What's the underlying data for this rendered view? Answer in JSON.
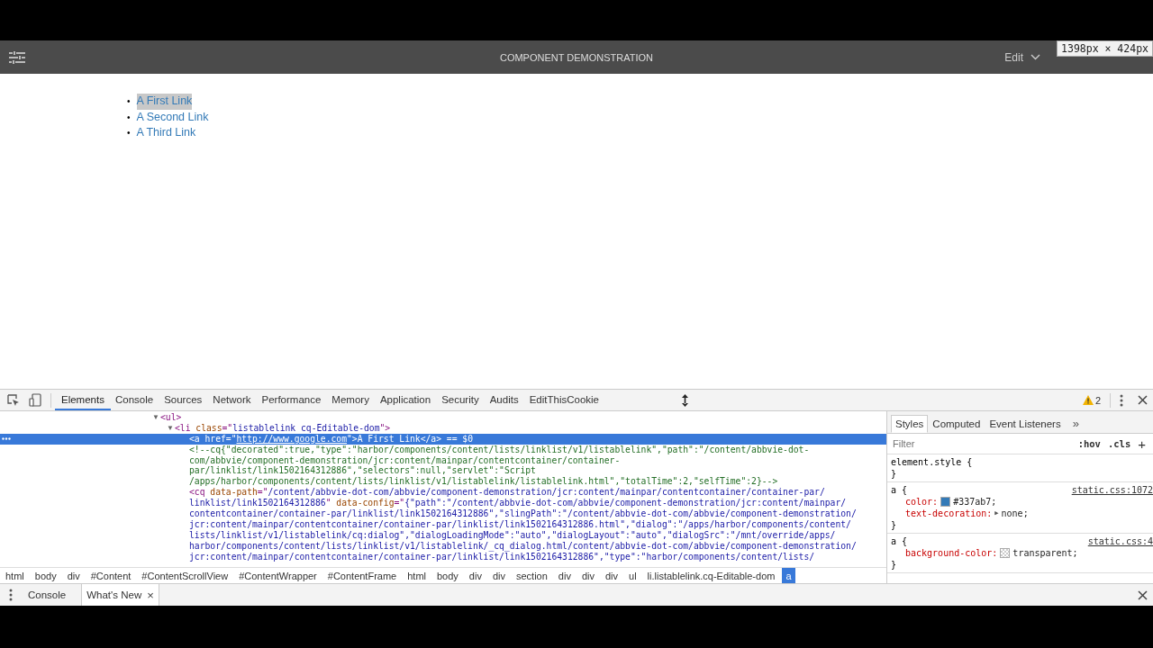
{
  "toolbar": {
    "title": "COMPONENT DEMONSTRATION",
    "mode": "Edit",
    "size_tooltip": "1398px × 424px"
  },
  "page": {
    "links": [
      {
        "bullet": "•",
        "text": "A First Link",
        "selected": true
      },
      {
        "bullet": "•",
        "text": "A Second Link",
        "selected": false
      },
      {
        "bullet": "•",
        "text": "A Third Link",
        "selected": false
      }
    ]
  },
  "devtools": {
    "tabs": [
      {
        "label": "Elements",
        "selected": true
      },
      {
        "label": "Console",
        "selected": false
      },
      {
        "label": "Sources",
        "selected": false
      },
      {
        "label": "Network",
        "selected": false
      },
      {
        "label": "Performance",
        "selected": false
      },
      {
        "label": "Memory",
        "selected": false
      },
      {
        "label": "Application",
        "selected": false
      },
      {
        "label": "Security",
        "selected": false
      },
      {
        "label": "Audits",
        "selected": false
      },
      {
        "label": "EditThisCookie",
        "selected": false
      }
    ],
    "warnings": "2",
    "elements": [
      {
        "arrow": "▼",
        "selected": false,
        "segments": [
          {
            "kind": "tag",
            "text": "<ul>"
          }
        ],
        "children": [
          {
            "arrow": "▼",
            "selected": false,
            "segments": [
              {
                "kind": "tag",
                "text": "<li "
              },
              {
                "kind": "attr",
                "text": "class"
              },
              {
                "kind": "tag",
                "text": "=\""
              },
              {
                "kind": "value",
                "text": "listablelink cq-Editable-dom"
              },
              {
                "kind": "tag",
                "text": "\">"
              }
            ],
            "children": [
              {
                "selected": true,
                "segments": [
                  {
                    "kind": "tag",
                    "text": "<a "
                  },
                  {
                    "kind": "attr",
                    "text": "href"
                  },
                  {
                    "kind": "tag",
                    "text": "=\""
                  },
                  {
                    "kind": "link",
                    "text": "http://www.google.com"
                  },
                  {
                    "kind": "tag",
                    "text": "\">"
                  },
                  {
                    "kind": "text",
                    "text": "A First Link"
                  },
                  {
                    "kind": "tag",
                    "text": "</a>"
                  },
                  {
                    "kind": "marker",
                    "text": " == $0"
                  }
                ]
              },
              {
                "selected": false,
                "segments": [
                  {
                    "kind": "comment",
                    "text": "<!--cq{\"decorated\":true,\"type\":\"harbor/components/content/lists/linklist/v1/listablelink\",\"path\":\"/content/abbvie-dot-"
                  }
                ]
              },
              {
                "selected": false,
                "segments": [
                  {
                    "kind": "comment",
                    "text": "com/abbvie/component-demonstration/jcr:content/mainpar/contentcontainer/container-"
                  }
                ]
              },
              {
                "selected": false,
                "segments": [
                  {
                    "kind": "comment",
                    "text": "par/linklist/link1502164312886\",\"selectors\":null,\"servlet\":\"Script"
                  }
                ]
              },
              {
                "selected": false,
                "segments": [
                  {
                    "kind": "comment",
                    "text": "/apps/harbor/components/content/lists/linklist/v1/listablelink/listablelink.html\",\"totalTime\":2,\"selfTime\":2}-->"
                  }
                ]
              },
              {
                "selected": false,
                "segments": [
                  {
                    "kind": "tag",
                    "text": "<cq "
                  },
                  {
                    "kind": "attr",
                    "text": "data-path"
                  },
                  {
                    "kind": "tag",
                    "text": "=\""
                  },
                  {
                    "kind": "value",
                    "text": "/content/abbvie-dot-com/abbvie/component-demonstration/jcr:content/mainpar/contentcontainer/container-par/"
                  }
                ]
              },
              {
                "selected": false,
                "segments": [
                  {
                    "kind": "value",
                    "text": "linklist/link1502164312886"
                  },
                  {
                    "kind": "tag",
                    "text": "\" "
                  },
                  {
                    "kind": "attr",
                    "text": "data-config"
                  },
                  {
                    "kind": "tag",
                    "text": "=\""
                  },
                  {
                    "kind": "value",
                    "text": "{\"path\":\"/content/abbvie-dot-com/abbvie/component-demonstration/jcr:content/mainpar/"
                  }
                ]
              },
              {
                "selected": false,
                "segments": [
                  {
                    "kind": "value",
                    "text": "contentcontainer/container-par/linklist/link1502164312886\",\"slingPath\":\"/content/abbvie-dot-com/abbvie/component-demonstration/"
                  }
                ]
              },
              {
                "selected": false,
                "segments": [
                  {
                    "kind": "value",
                    "text": "jcr:content/mainpar/contentcontainer/container-par/linklist/link1502164312886.html\",\"dialog\":\"/apps/harbor/components/content/"
                  }
                ]
              },
              {
                "selected": false,
                "segments": [
                  {
                    "kind": "value",
                    "text": "lists/linklist/v1/listablelink/cq:dialog\",\"dialogLoadingMode\":\"auto\",\"dialogLayout\":\"auto\",\"dialogSrc\":\"/mnt/override/apps/"
                  }
                ]
              },
              {
                "selected": false,
                "segments": [
                  {
                    "kind": "value",
                    "text": "harbor/components/content/lists/linklist/v1/listablelink/_cq_dialog.html/content/abbvie-dot-com/abbvie/component-demonstration/"
                  }
                ]
              },
              {
                "selected": false,
                "segments": [
                  {
                    "kind": "value",
                    "text": "jcr:content/mainpar/contentcontainer/container-par/linklist/link1502164312886\",\"type\":\"harbor/components/content/lists/"
                  }
                ]
              }
            ]
          }
        ]
      }
    ],
    "breadcrumbs": [
      {
        "label": "html",
        "selected": false
      },
      {
        "label": "body",
        "selected": false
      },
      {
        "label": "div",
        "selected": false
      },
      {
        "label": "#Content",
        "selected": false
      },
      {
        "label": "#ContentScrollView",
        "selected": false
      },
      {
        "label": "#ContentWrapper",
        "selected": false
      },
      {
        "label": "#ContentFrame",
        "selected": false
      },
      {
        "label": "html",
        "selected": false
      },
      {
        "label": "body",
        "selected": false
      },
      {
        "label": "div",
        "selected": false
      },
      {
        "label": "div",
        "selected": false
      },
      {
        "label": "section",
        "selected": false
      },
      {
        "label": "div",
        "selected": false
      },
      {
        "label": "div",
        "selected": false
      },
      {
        "label": "div",
        "selected": false
      },
      {
        "label": "ul",
        "selected": false
      },
      {
        "label": "li.listablelink.cq-Editable-dom",
        "selected": false
      },
      {
        "label": "a",
        "selected": true
      }
    ],
    "styles": {
      "tabs": [
        {
          "label": "Styles",
          "selected": true
        },
        {
          "label": "Computed",
          "selected": false
        },
        {
          "label": "Event Listeners",
          "selected": false
        }
      ],
      "more": "»",
      "filter": {
        "placeholder": "Filter"
      },
      "hov": ":hov",
      "cls": ".cls",
      "add": "+",
      "rules": [
        {
          "selector": "element.style {",
          "close": "}"
        },
        {
          "selector": "a {",
          "source": "static.css:1072",
          "declarations": [
            {
              "kind": "color",
              "property": "color:",
              "value": "#337ab7;",
              "color": "#337ab7"
            },
            {
              "kind": "plain",
              "property": "text-decoration:",
              "toggle": "▶",
              "value": "none;"
            }
          ],
          "close": "}"
        },
        {
          "selector": "a {",
          "source": "static.css:4",
          "declarations": [
            {
              "kind": "transparent",
              "property": "background-color:",
              "value": "transparent;"
            }
          ],
          "close": "}"
        }
      ]
    }
  },
  "drawer": {
    "tabs": [
      {
        "label": "Console",
        "selected": false
      },
      {
        "label": "What's New",
        "selected": true,
        "close": "×"
      }
    ]
  }
}
